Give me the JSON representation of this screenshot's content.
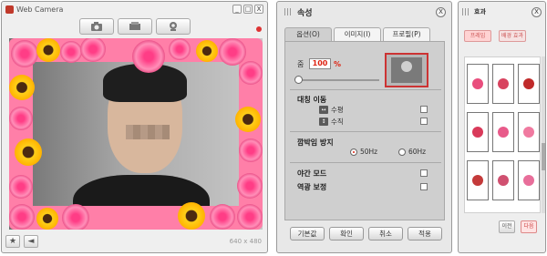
{
  "webcam": {
    "title": "Web Camera",
    "toolbar": [
      "camera-icon",
      "video-camera-icon",
      "webcam-icon"
    ],
    "resolution": "640 x 480",
    "bottom_icons": [
      "star-icon",
      "speaker-icon"
    ],
    "window_buttons": [
      "_",
      "□",
      "X"
    ]
  },
  "properties": {
    "title": "속성",
    "close": "X",
    "tabs": [
      {
        "label": "옵션(O)",
        "active": true
      },
      {
        "label": "이미지(I)",
        "active": false
      },
      {
        "label": "프로필(P)",
        "active": false
      }
    ],
    "zoom": {
      "label": "줌",
      "value": "100",
      "unit": "%"
    },
    "flip": {
      "section": "대칭 이동",
      "horizontal": "수평",
      "vertical": "수직"
    },
    "flicker": {
      "section": "깜박임 방지",
      "option1": "50Hz",
      "option2": "60Hz",
      "selected": "50Hz"
    },
    "night_mode": "야간 모드",
    "backlight": "역광 보정",
    "buttons": {
      "default": "기본값",
      "ok": "확인",
      "cancel": "취소",
      "apply": "적용"
    }
  },
  "effects": {
    "title": "효과",
    "close": "X",
    "tabs": [
      "프레임",
      "배경 효과"
    ],
    "pages": [
      "이전",
      "다음"
    ],
    "frame_colors": [
      "#e94e7d",
      "#d8435f",
      "#c02a2a",
      "#d93a5a",
      "#e85a8a",
      "#f07aa0",
      "#c43a3a",
      "#d05070",
      "#e86e9a"
    ]
  },
  "colors": {
    "accent_red": "#d21f1f",
    "frame_pink": "#ff7fa8"
  }
}
